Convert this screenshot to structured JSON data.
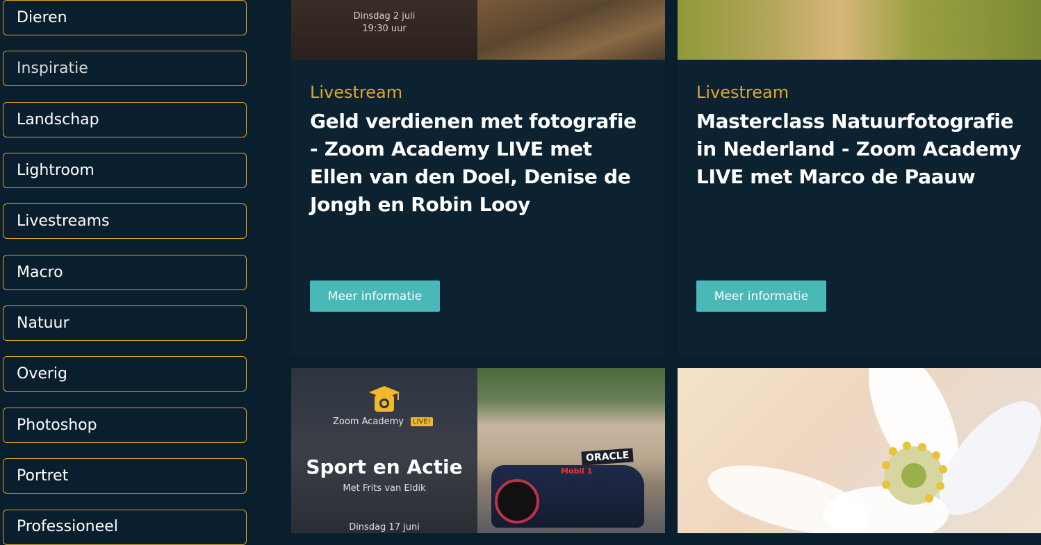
{
  "sidebar": {
    "categories": [
      "Dieren",
      "Inspiratie",
      "Landschap",
      "Lightroom",
      "Livestreams",
      "Macro",
      "Natuur",
      "Overig",
      "Photoshop",
      "Portret",
      "Professioneel"
    ]
  },
  "cards": [
    {
      "promo_date": "Dinsdag 2 juli",
      "promo_time": "19:30 uur",
      "tag": "Livestream",
      "title": "Geld verdienen met fotografie - Zoom Academy LIVE met Ellen van den Doel, Denise de Jongh en Robin Looy",
      "button": "Meer informatie"
    },
    {
      "tag": "Livestream",
      "title": "Masterclass Natuurfotografie in Nederland - Zoom Academy LIVE met Marco de Paauw",
      "button": "Meer informatie"
    },
    {
      "promo_brand": "Zoom Academy",
      "promo_badge": "LIVE!",
      "promo_title": "Sport en Actie",
      "promo_subtitle": "Met Frits van Eldik",
      "promo_date": "Dinsdag 17 juni",
      "sponsor_text": "ORACLE",
      "car_text": "Mobil 1"
    },
    {}
  ],
  "colors": {
    "background": "#0a1f2e",
    "card": "#0c2230",
    "accent": "#e3a42b",
    "button": "#48b9b7"
  }
}
